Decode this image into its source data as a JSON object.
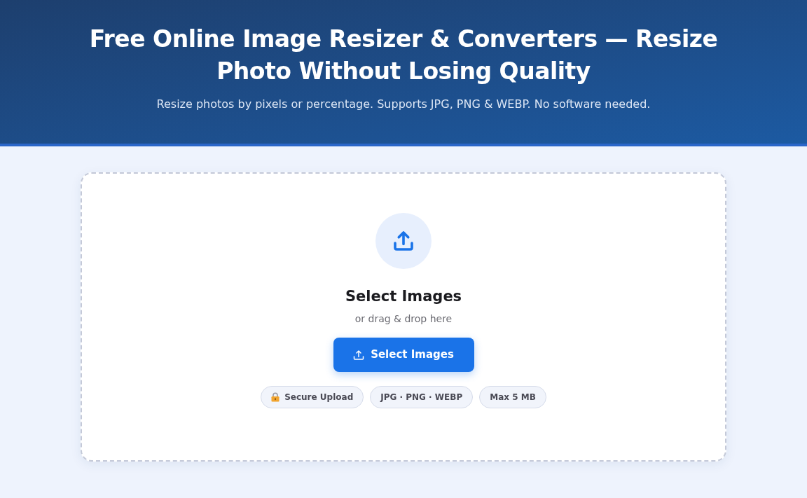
{
  "header": {
    "title": "Free Online Image Resizer & Converters — Resize Photo Without Losing Quality",
    "subtitle": "Resize photos by pixels or percentage. Supports JPG, PNG & WEBP. No software needed."
  },
  "upload": {
    "heading": "Select Images",
    "hint": "or drag & drop here",
    "button": "Select Images",
    "badges": [
      {
        "kind": "lock",
        "label": "Secure Upload"
      },
      {
        "kind": "plain",
        "label": "JPG · PNG · WEBP"
      },
      {
        "kind": "plain",
        "label": "Max 5 MB"
      }
    ]
  }
}
